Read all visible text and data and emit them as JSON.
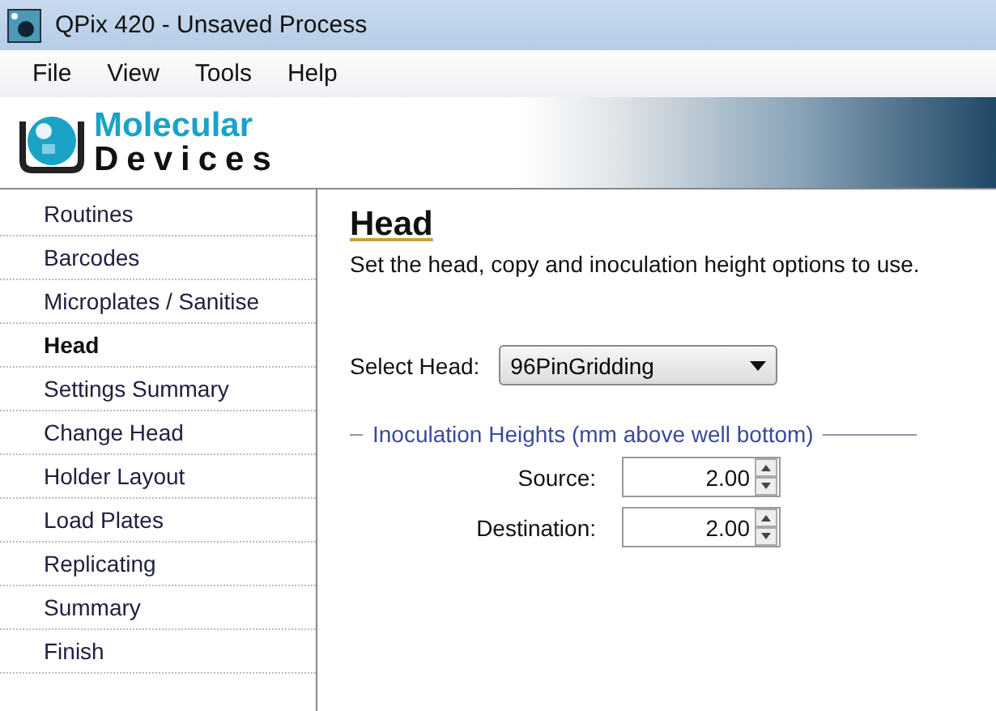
{
  "window": {
    "title": "QPix 420 - Unsaved Process"
  },
  "menu": [
    "File",
    "View",
    "Tools",
    "Help"
  ],
  "logo": {
    "line_1": "Molecular",
    "line_2": "Devices"
  },
  "sidebar": {
    "items": [
      {
        "label": "Routines",
        "selected": false
      },
      {
        "label": "Barcodes",
        "selected": false
      },
      {
        "label": "Microplates / Sanitise",
        "selected": false
      },
      {
        "label": "Head",
        "selected": true
      },
      {
        "label": "Settings Summary",
        "selected": false
      },
      {
        "label": "Change Head",
        "selected": false
      },
      {
        "label": "Holder Layout",
        "selected": false
      },
      {
        "label": "Load Plates",
        "selected": false
      },
      {
        "label": "Replicating",
        "selected": false
      },
      {
        "label": "Summary",
        "selected": false
      },
      {
        "label": "Finish",
        "selected": false
      }
    ]
  },
  "page": {
    "heading": "Head",
    "description": "Set the head, copy and inoculation height options to use.",
    "select_head": {
      "label": "Select Head:",
      "value": "96PinGridding"
    },
    "group": {
      "title": "Inoculation Heights (mm above well bottom)",
      "fields": [
        {
          "label": "Source:",
          "value": "2.00"
        },
        {
          "label": "Destination:",
          "value": "2.00"
        }
      ]
    }
  }
}
